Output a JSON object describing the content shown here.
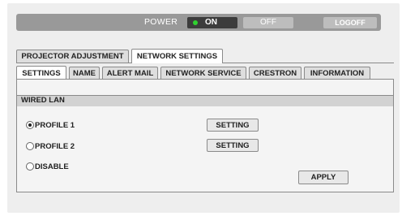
{
  "power": {
    "label": "POWER",
    "on_label": "ON",
    "off_label": "OFF",
    "logoff_label": "LOGOFF",
    "state": "on",
    "indicator_color": "#2fd12f"
  },
  "main_tabs": [
    {
      "label": "PROJECTOR ADJUSTMENT",
      "active": false
    },
    {
      "label": "NETWORK SETTINGS",
      "active": true
    }
  ],
  "sub_tabs": [
    {
      "label": "SETTINGS",
      "active": true
    },
    {
      "label": "NAME",
      "active": false
    },
    {
      "label": "ALERT MAIL",
      "active": false
    },
    {
      "label": "NETWORK SERVICE",
      "active": false
    },
    {
      "label": "CRESTRON",
      "active": false
    },
    {
      "label": "INFORMATION",
      "active": false
    }
  ],
  "wired_lan": {
    "title": "WIRED LAN",
    "options": [
      {
        "label": "PROFILE 1",
        "selected": true,
        "setting_label": "SETTING"
      },
      {
        "label": "PROFILE 2",
        "selected": false,
        "setting_label": "SETTING"
      },
      {
        "label": "DISABLE",
        "selected": false
      }
    ],
    "apply_label": "APPLY"
  }
}
